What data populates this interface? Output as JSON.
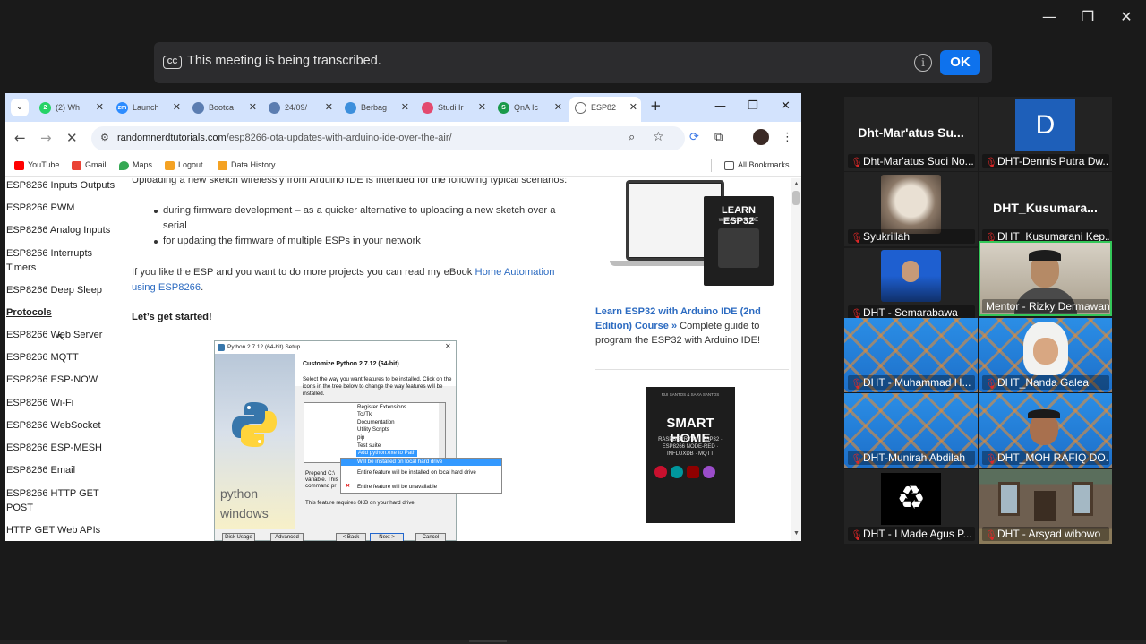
{
  "banner": {
    "message": "This meeting is being transcribed.",
    "ok_label": "OK",
    "cc_label": "CC"
  },
  "window_controls": {
    "minimize": "—",
    "restore": "❐",
    "close": "✕"
  },
  "browser": {
    "tabs": [
      {
        "label": "(2) Wh",
        "icon_color": "#25d366",
        "icon_text": "2"
      },
      {
        "label": "Launch",
        "icon_color": "#2d8cff",
        "icon_text": "zm"
      },
      {
        "label": "Bootca",
        "icon_color": "#5b7db1",
        "icon_text": ""
      },
      {
        "label": "24/09/",
        "icon_color": "#5b7db1",
        "icon_text": ""
      },
      {
        "label": "Berbag",
        "icon_color": "#3c8fdc",
        "icon_text": ""
      },
      {
        "label": "Studi Ir",
        "icon_color": "#e34a6f",
        "icon_text": ""
      },
      {
        "label": "QnA Ic",
        "icon_color": "#1a9a4a",
        "icon_text": "S"
      },
      {
        "label": "ESP82",
        "icon_color": "#666666",
        "icon_text": ""
      }
    ],
    "new_tab": "+",
    "url_domain": "randomnerdtutorials.com",
    "url_path": "/esp8266-ota-updates-with-arduino-ide-over-the-air/",
    "bookmarks": [
      {
        "label": "YouTube",
        "color": "#ff0000"
      },
      {
        "label": "Gmail",
        "color": "#ea4335"
      },
      {
        "label": "Maps",
        "color": "#34a853"
      },
      {
        "label": "Logout",
        "color": "#f4a223"
      },
      {
        "label": "Data History",
        "color": "#f4a223"
      }
    ],
    "all_bookmarks": "All Bookmarks"
  },
  "sidebar": [
    {
      "label": "ESP8266 Inputs Outputs"
    },
    {
      "label": "ESP8266 PWM"
    },
    {
      "label": "ESP8266 Analog Inputs"
    },
    {
      "label": "ESP8266 Interrupts Timers"
    },
    {
      "label": "ESP8266 Deep Sleep"
    },
    {
      "label": "Protocols"
    },
    {
      "label": "ESP8266 Web Server"
    },
    {
      "label": "ESP8266 MQTT"
    },
    {
      "label": "ESP8266 ESP-NOW"
    },
    {
      "label": "ESP8266 Wi-Fi"
    },
    {
      "label": "ESP8266 WebSocket"
    },
    {
      "label": "ESP8266 ESP-MESH"
    },
    {
      "label": "ESP8266 Email"
    },
    {
      "label": "ESP8266 HTTP GET POST"
    },
    {
      "label": "HTTP GET Web APIs"
    }
  ],
  "article": {
    "intro": "Uploading a new sketch wirelessly from Arduino IDE is intended for the following typical scenarios:",
    "bullet1": "during firmware development – as a quicker alternative to uploading a new sketch over a serial",
    "bullet2": "for updating the firmware of multiple ESPs in your network",
    "para_prefix": "If you like the ESP and you want to do more projects you can read my eBook ",
    "para_link": "Home Automation using ESP8266",
    "para_suffix": ".",
    "started": "Let’s get started!"
  },
  "python_setup": {
    "title": "Python 2.7.12 (64-bit) Setup",
    "heading": "Customize Python 2.7.12 (64-bit)",
    "desc": "Select the way you want features to be installed. Click on the icons in the tree below to change the way features will be installed.",
    "features": [
      "Register Extensions",
      "Tcl/Tk",
      "Documentation",
      "Utility Scripts",
      "pip",
      "Test suite",
      "Add python.exe to Path"
    ],
    "menu": [
      "Will be installed on local hard drive",
      "Entire feature will be installed on local hard drive",
      "Entire feature will be unavailable"
    ],
    "prepend": "Prepend C:\\",
    "variable": "variable. This",
    "command": "command pr",
    "note": "This feature requires 0KB on your hard drive.",
    "brand_line1": "python",
    "brand_line2": "windows",
    "buttons": [
      "Disk Usage",
      "Advanced",
      "< Back",
      "Next >",
      "Cancel"
    ]
  },
  "promo": {
    "book1_title": "LEARN ESP32",
    "book1_sub": "with Arduino IDE",
    "course_link": "Learn ESP32 with Arduino IDE (2nd Edition) Course »",
    "course_desc": " Complete guide to program the ESP32 with Arduino IDE!",
    "book2_top": "RUI SANTOS & SARA SANTOS",
    "book2_title": "SMART HOME",
    "book2_sub": "RASPBERRY PI · ESP32 · ESP8266 NODE-RED · INFLUXDB · MQTT"
  },
  "participants": [
    {
      "name": "Dht-Mar'atus Suci No...",
      "display": "Dht-Mar'atus  Su...",
      "type": "text"
    },
    {
      "name": "DHT-Dennis Putra Dw...",
      "display": "D",
      "type": "letter"
    },
    {
      "name": "Syukrillah",
      "display": "",
      "type": "cat"
    },
    {
      "name": "DHT_Kusumarani Kep...",
      "display": "DHT_Kusumara...",
      "type": "text"
    },
    {
      "name": "DHT - Semarabawa",
      "display": "",
      "type": "person"
    },
    {
      "name": "Mentor - Rizky Dermawan",
      "display": "",
      "type": "video"
    },
    {
      "name": "DHT - Muhammad H...",
      "display": "",
      "type": "pattern"
    },
    {
      "name": "DHT_Nanda Galea",
      "display": "",
      "type": "hijab"
    },
    {
      "name": "DHT-Munirah Abdilah",
      "display": "",
      "type": "pattern"
    },
    {
      "name": "DHT_MOH RAFIQ DO...",
      "display": "",
      "type": "video2"
    },
    {
      "name": "DHT - I Made Agus P...",
      "display": "",
      "type": "recycle"
    },
    {
      "name": "DHT - Arsyad wibowo",
      "display": "",
      "type": "house"
    }
  ],
  "colors": {
    "accent": "#0e72ed",
    "speaking": "#34c759",
    "muted": "#e02828",
    "link": "#2c6bc1"
  }
}
